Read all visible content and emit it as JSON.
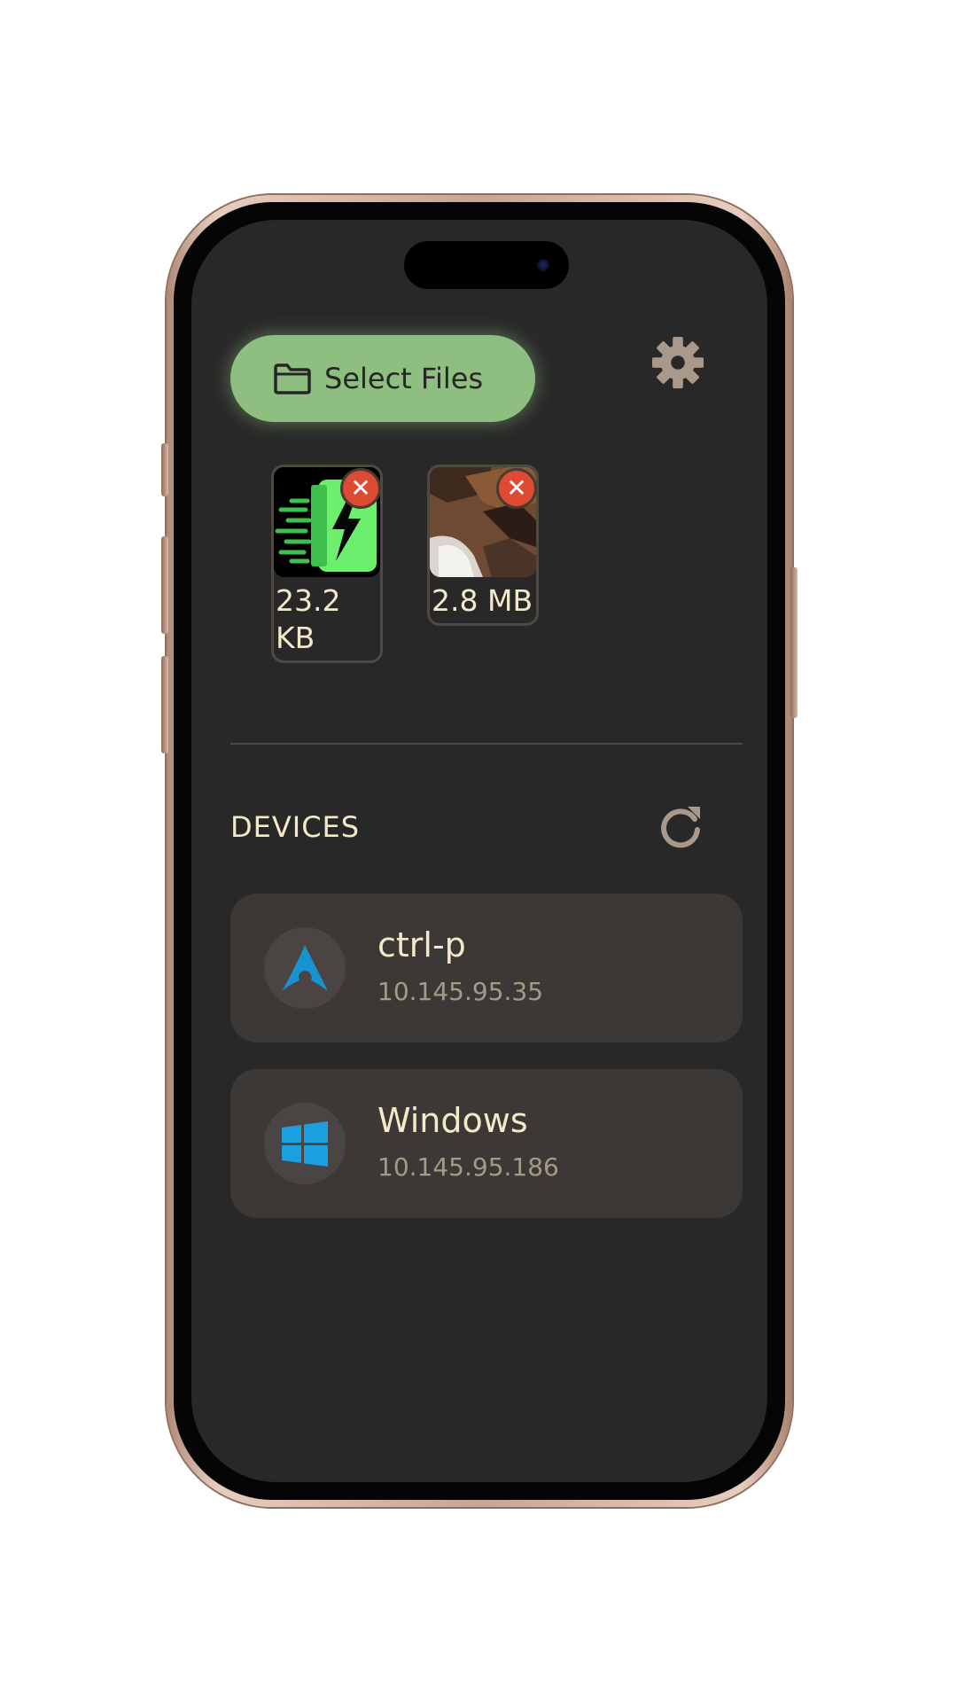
{
  "toolbar": {
    "select_files_label": "Select Files",
    "folder_icon": "folder-icon",
    "settings_icon": "gear-icon"
  },
  "files": [
    {
      "size": "23.2 KB",
      "thumbnail": "app-logo-thumbnail",
      "remove_icon": "close-icon"
    },
    {
      "size": "2.8 MB",
      "thumbnail": "photo-thumbnail",
      "remove_icon": "close-icon"
    }
  ],
  "devices_section": {
    "title": "DEVICES",
    "refresh_icon": "refresh-icon"
  },
  "devices": [
    {
      "name": "ctrl-p",
      "ip": "10.145.95.35",
      "icon": "arch-linux-icon"
    },
    {
      "name": "Windows",
      "ip": "10.145.95.186",
      "icon": "windows-icon"
    }
  ],
  "colors": {
    "background": "#282828",
    "accent_green": "#8ebe80",
    "remove_red": "#dd4b35",
    "text_cream": "#f4e9c9",
    "text_muted": "#a59a86",
    "card": "#3c3835",
    "os_icon_blue": "#1793d1"
  }
}
